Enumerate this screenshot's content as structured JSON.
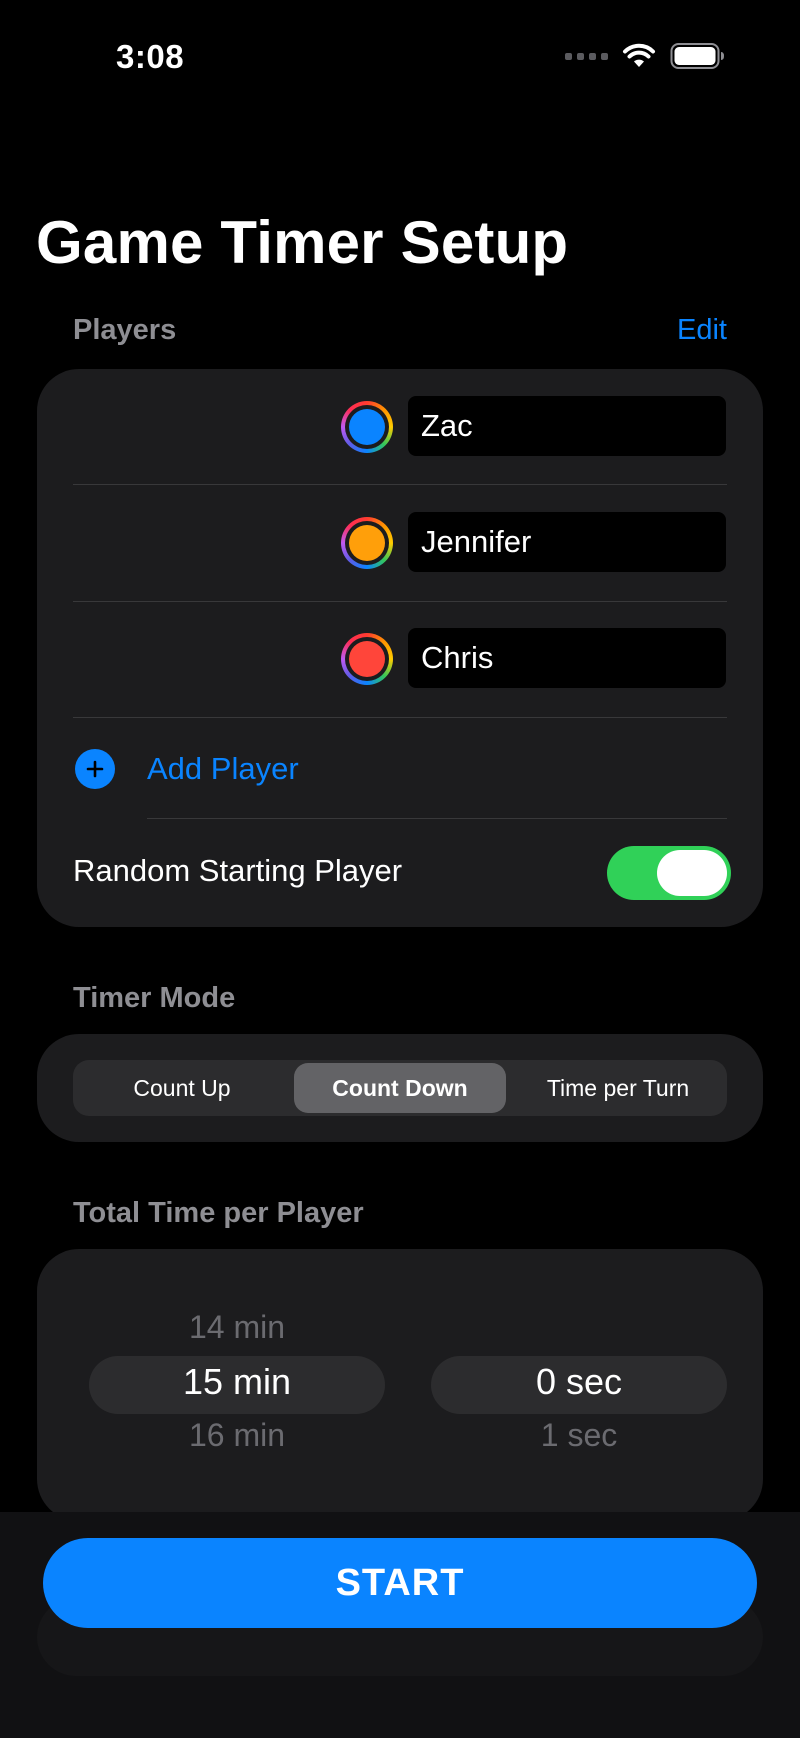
{
  "status_bar": {
    "time": "3:08",
    "icons": [
      "signal-dots-icon",
      "wifi-icon",
      "battery-icon"
    ]
  },
  "title": "Game Timer Setup",
  "players_section": {
    "header": "Players",
    "edit_label": "Edit",
    "players": [
      {
        "name": "Zac",
        "color": "#0a84ff"
      },
      {
        "name": "Jennifer",
        "color": "#ff9f0a"
      },
      {
        "name": "Chris",
        "color": "#ff453a"
      }
    ],
    "add_player_label": "Add Player",
    "random_start_label": "Random Starting Player",
    "random_start_enabled": true
  },
  "timer_mode_section": {
    "header": "Timer Mode",
    "options": [
      "Count Up",
      "Count Down",
      "Time per Turn"
    ],
    "selected": "Count Down"
  },
  "total_time_section": {
    "header": "Total Time per Player",
    "minutes": {
      "prev": "14 min",
      "current": "15 min",
      "next": "16 min"
    },
    "seconds": {
      "prev": "",
      "current": "0 sec",
      "next": "1 sec"
    }
  },
  "start_label": "START",
  "colors": {
    "accent": "#0a84ff",
    "toggle_on": "#30d158",
    "card_bg": "#1c1c1e"
  }
}
